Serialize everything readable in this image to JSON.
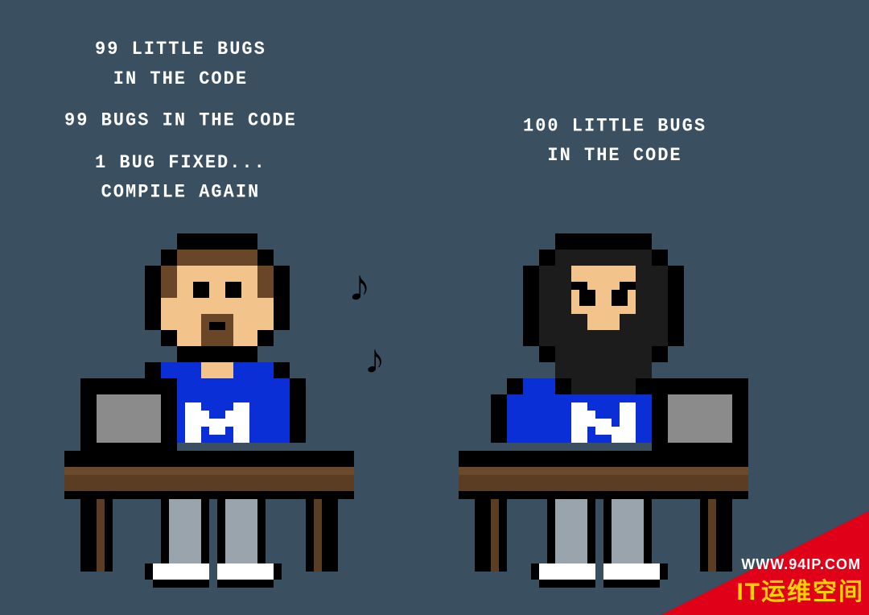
{
  "left_caption": {
    "l1": "99 LITTLE BUGS",
    "l2": "IN THE CODE",
    "l3": "99 BUGS IN THE CODE",
    "l4": "1 BUG FIXED...",
    "l5": "COMPILE AGAIN"
  },
  "right_caption": {
    "l1": "100 LITTLE BUGS",
    "l2": "IN THE CODE"
  },
  "banner": {
    "url": "WWW.94IP.COM",
    "site_name": "IT运维空间"
  },
  "palette": {
    "bg": "#3a5060",
    "outline": "#000000",
    "skin": "#f2c38a",
    "hair": "#6a4628",
    "hair_dark": "#1c1c1c",
    "shirt": "#0b2fd6",
    "shirt_logo": "#ffffff",
    "monitor": "#8b8b8b",
    "desk": "#5a3d22",
    "desk_light": "#6a4a2b",
    "pants": "#9aa4ac",
    "shoe": "#ffffff",
    "note": "#000000"
  }
}
